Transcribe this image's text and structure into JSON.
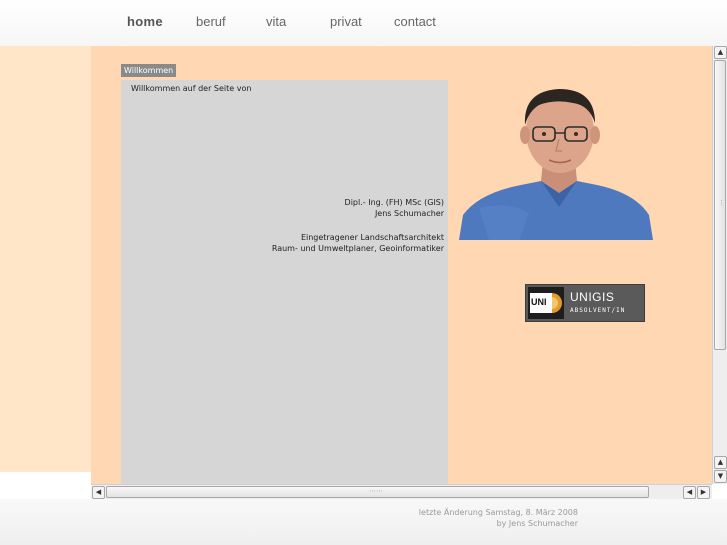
{
  "nav": {
    "items": [
      {
        "label": "home",
        "active": true
      },
      {
        "label": "beruf",
        "active": false
      },
      {
        "label": "vita",
        "active": false
      },
      {
        "label": "privat",
        "active": false
      },
      {
        "label": "contact",
        "active": false
      }
    ]
  },
  "page": {
    "title_tab": "Willkommen",
    "welcome_text": "Willkommen auf der Seite von",
    "credentials": {
      "line1": "Dipl.- Ing. (FH) MSc (GIS)",
      "line2": "Jens Schumacher",
      "line3": "Eingetragener Landschaftsarchitekt",
      "line4": "Raum- und Umweltplaner, Geoinformatiker"
    },
    "badge": {
      "logo_text": "UNI",
      "title": "UNIGIS",
      "subtitle": "ABSOLVENT/IN"
    }
  },
  "footer": {
    "line1": "letzte Änderung Samstag, 8. März 2008",
    "line2": "by Jens Schumacher"
  },
  "colors": {
    "frame_bg": "#ffd7b2",
    "left_strip": "#ffe6c8",
    "content_box": "#d6d6d6",
    "tab_bg": "#8a8a8a"
  }
}
